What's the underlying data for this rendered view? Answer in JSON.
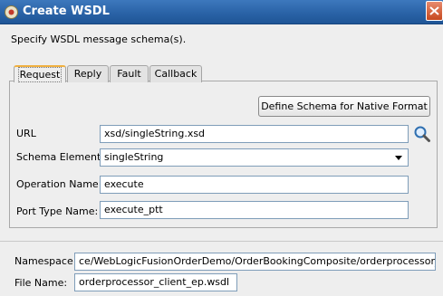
{
  "window": {
    "title": "Create WSDL"
  },
  "subtitle": "Specify WSDL message schema(s).",
  "tabs": [
    {
      "label": "Request",
      "active": true
    },
    {
      "label": "Reply",
      "active": false
    },
    {
      "label": "Fault",
      "active": false
    },
    {
      "label": "Callback",
      "active": false
    }
  ],
  "define_schema_button": "Define Schema for Native Format",
  "fields": {
    "url": {
      "label": "URL",
      "value": "xsd/singleString.xsd"
    },
    "schema_element": {
      "label": "Schema Element",
      "value": "singleString"
    },
    "operation_name": {
      "label": "Operation Name:",
      "value": "execute"
    },
    "port_type_name": {
      "label": "Port Type Name:",
      "value": "execute_ptt"
    },
    "namespace": {
      "label": "Namespace:",
      "value": "ce/WebLogicFusionOrderDemo/OrderBookingComposite/orderprocessor_client_ep"
    },
    "file_name": {
      "label": "File Name:",
      "value": "orderprocessor_client_ep.wsdl"
    }
  }
}
